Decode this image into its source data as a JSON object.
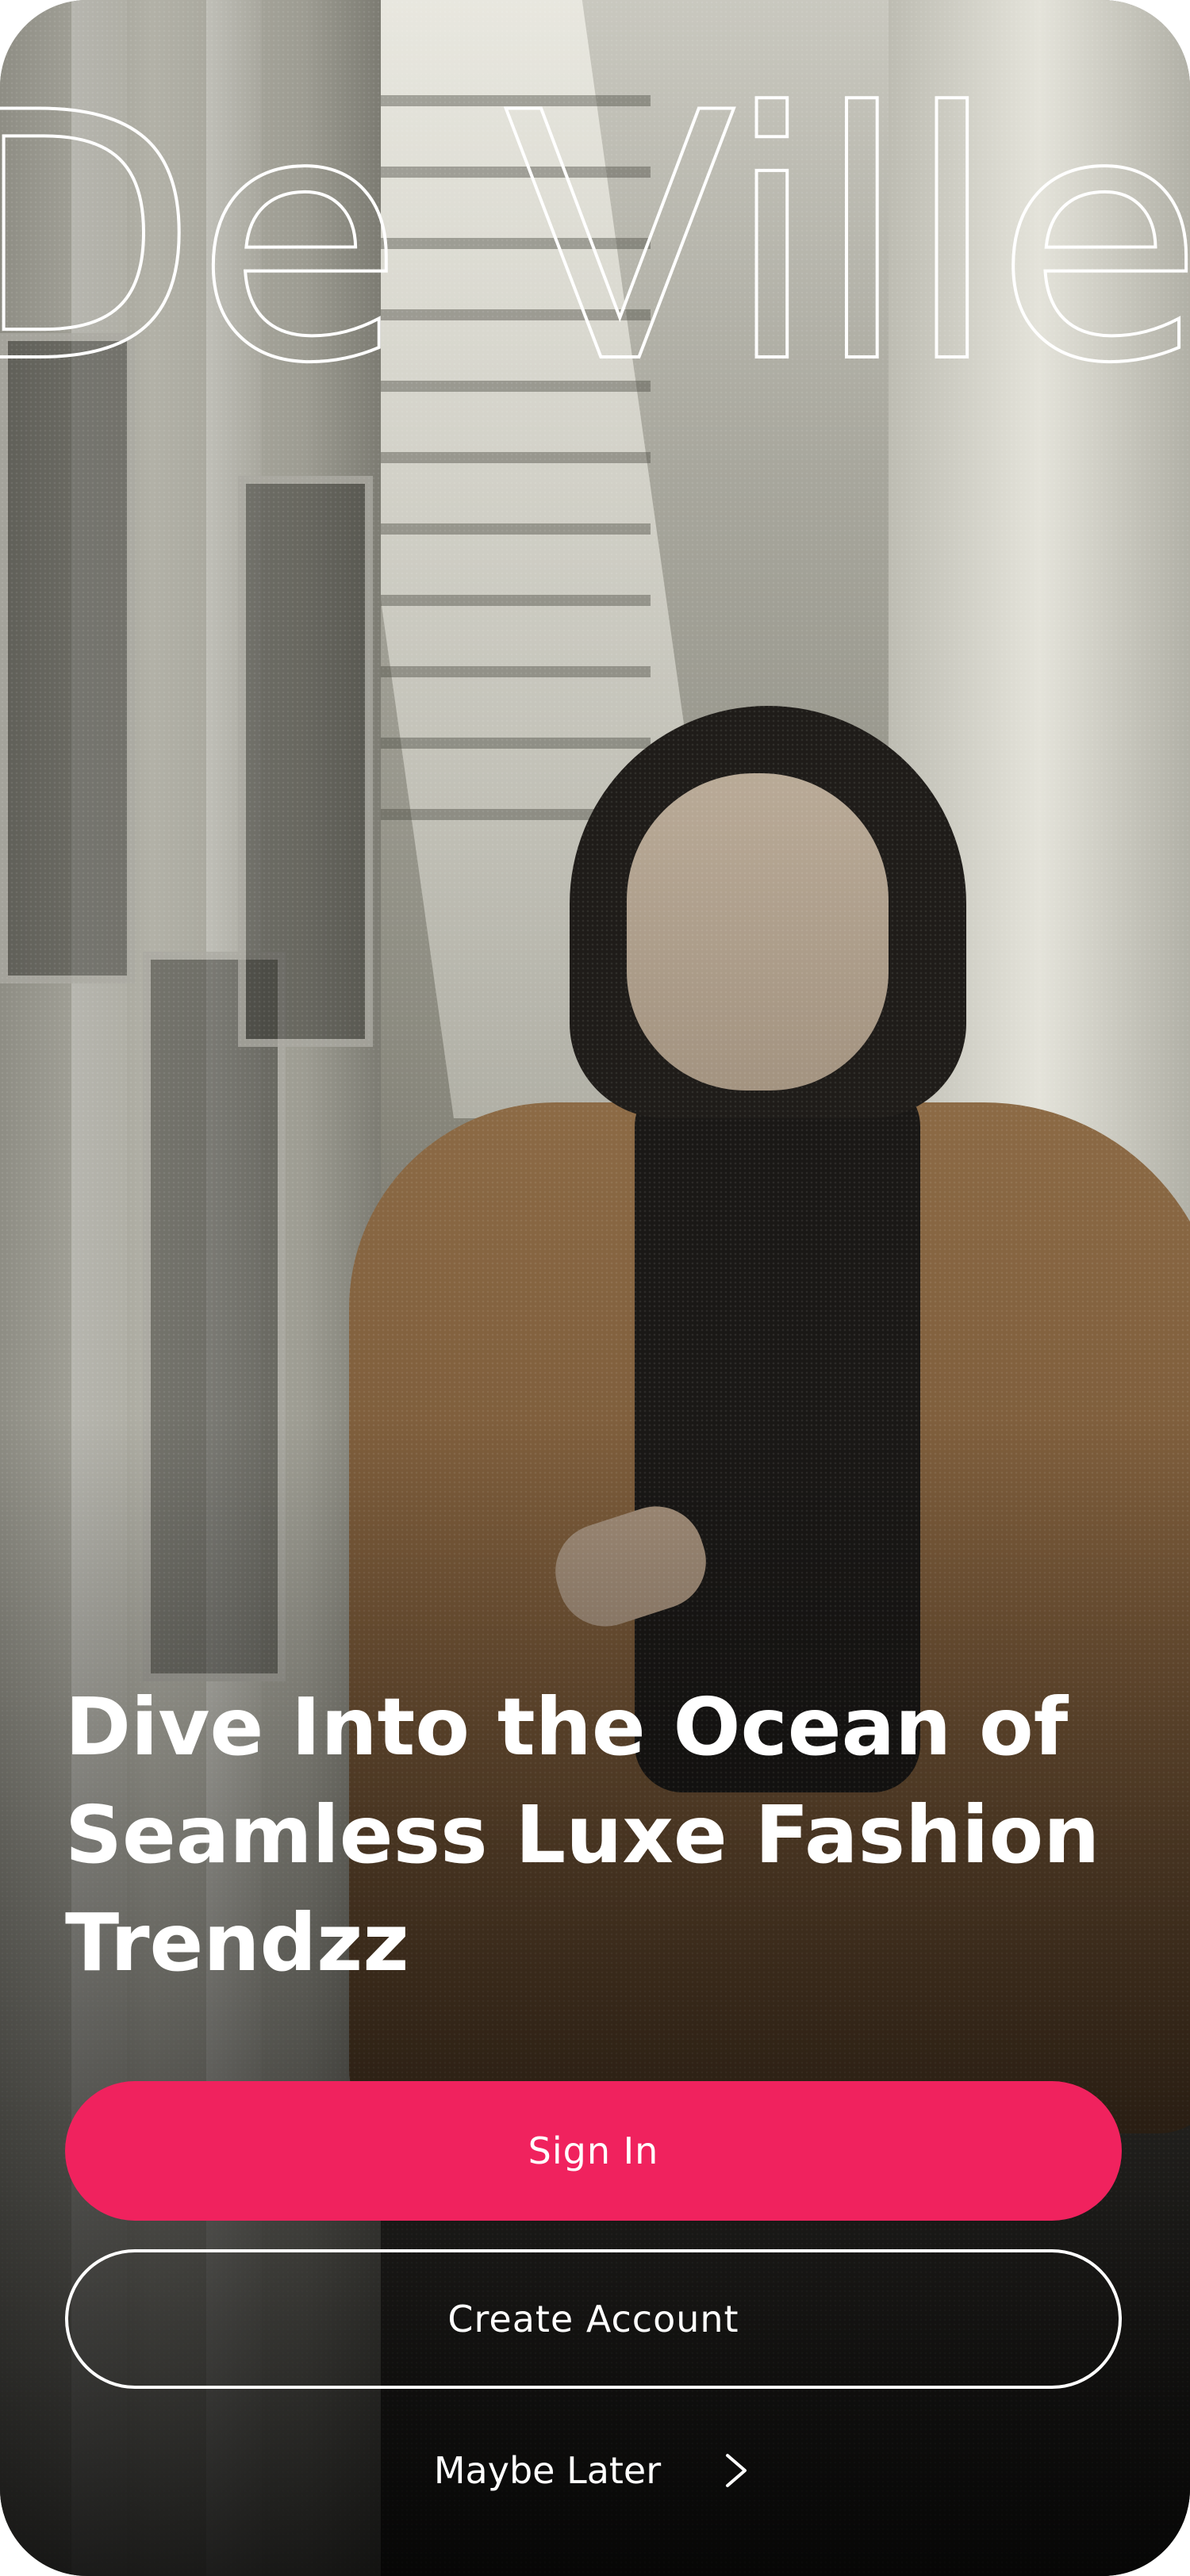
{
  "brand": {
    "wordmark": "De Ville"
  },
  "hero": {
    "headline": "Dive Into the Ocean of Seamless Luxe Fashion Trendzz"
  },
  "actions": {
    "sign_in_label": "Sign In",
    "create_account_label": "Create Account",
    "maybe_later_label": "Maybe Later"
  },
  "icons": {
    "maybe_later": "chevron-right-icon"
  },
  "colors": {
    "primary_button": "#f0225e",
    "text": "#ffffff"
  }
}
